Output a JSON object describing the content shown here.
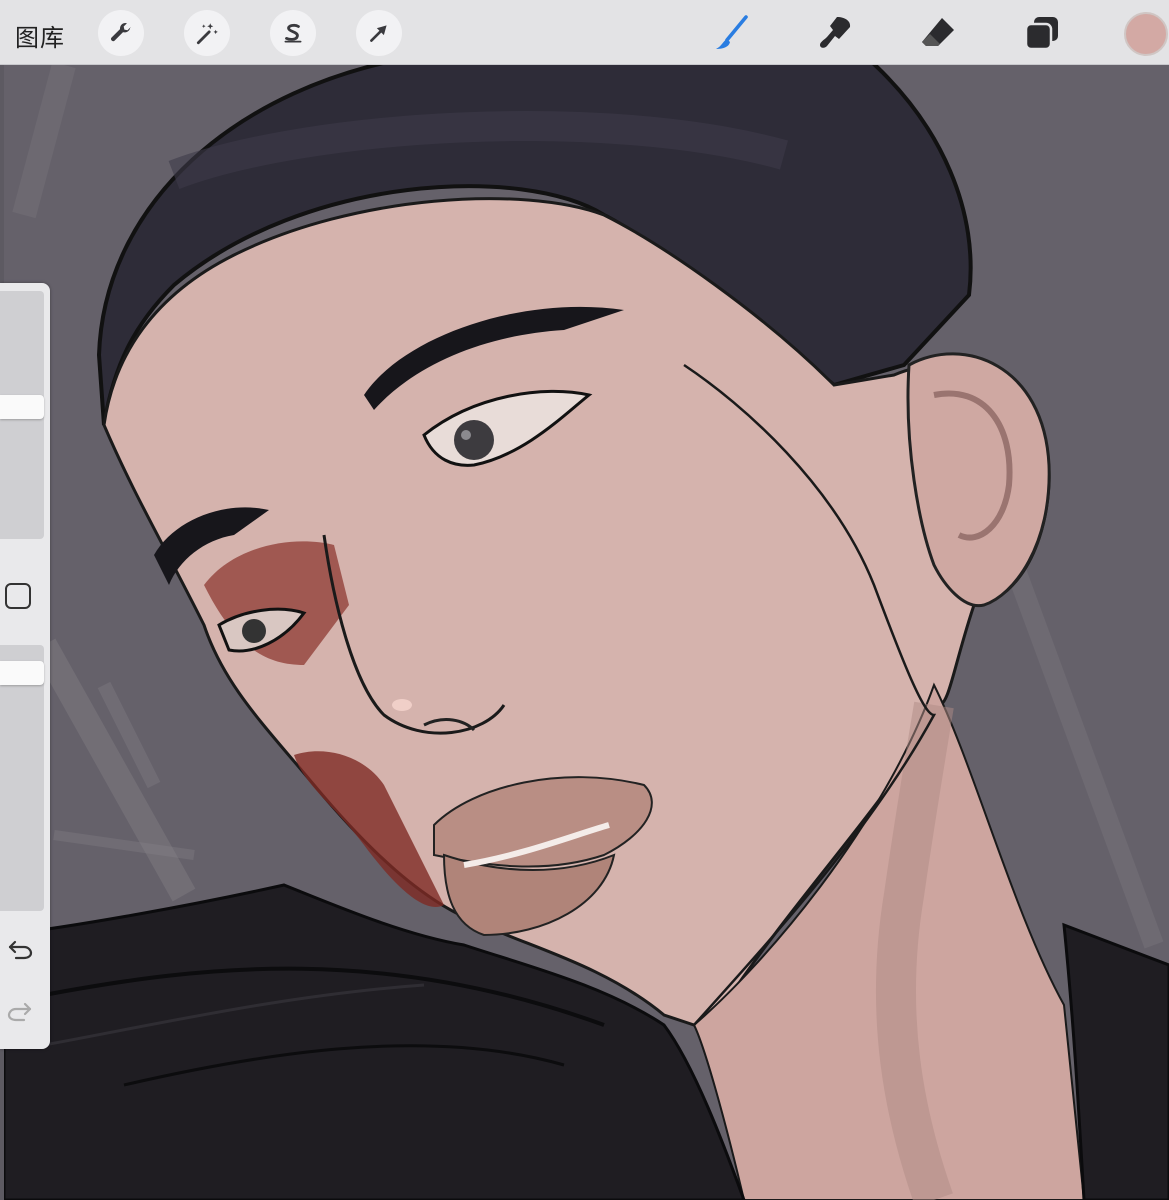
{
  "toolbar": {
    "gallery_label": "图库",
    "actions_icon": "wrench-icon",
    "adjustments_icon": "magic-wand-icon",
    "selection_icon": "selection-s-icon",
    "transform_icon": "arrow-cursor-icon",
    "brush_icon": "brush-icon",
    "smudge_icon": "smudge-icon",
    "eraser_icon": "eraser-icon",
    "layers_icon": "layers-icon",
    "active_tool": "brush",
    "active_color": "#d3a9a4",
    "accent_color": "#2a7de1"
  },
  "sidebar": {
    "brush_size_icon": "brush-size-slider",
    "opacity_icon": "opacity-slider",
    "modify_icon": "square-modify-icon",
    "undo_icon": "undo-arrow-icon",
    "redo_icon": "redo-arrow-icon"
  },
  "canvas": {
    "background_color": "#65616a",
    "skin_color": "#d5b3ad",
    "hair_color": "#2e2c38",
    "clothing_color": "#1f1d22"
  }
}
